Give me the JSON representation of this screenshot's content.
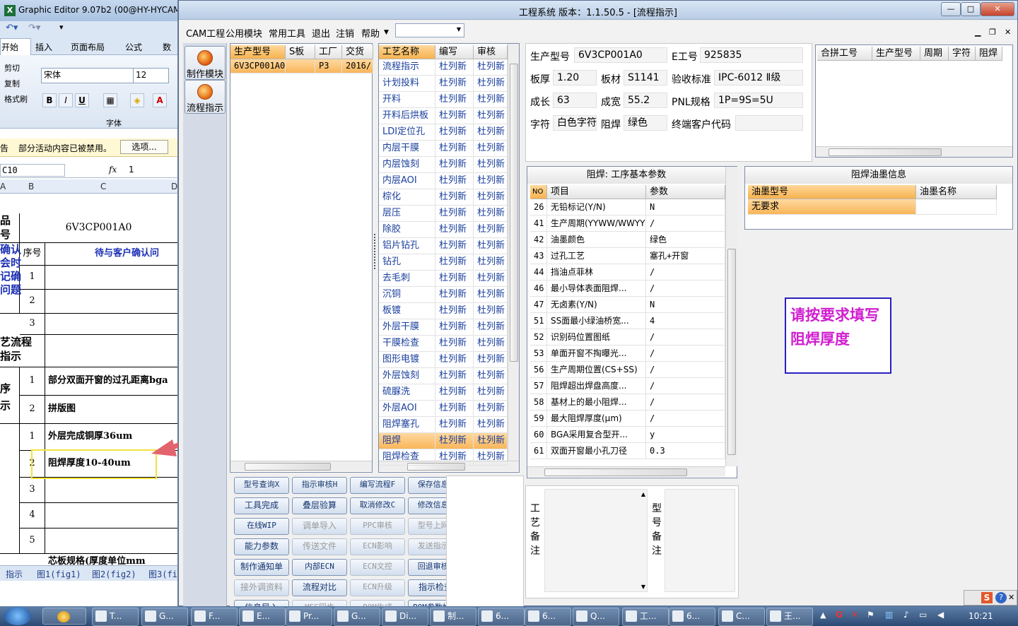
{
  "excel": {
    "title": "Graphic Editor 9.07b2 (00@HY-HYCAM",
    "tabs": [
      "开始",
      "插入",
      "页面布局",
      "公式",
      "数"
    ],
    "clip": {
      "cut": "剪切",
      "copy": "复制",
      "painter": "格式刷"
    },
    "font_name": "宋体",
    "font_size": "12",
    "group_font": "字体",
    "msg": "部分活动内容已被禁用。",
    "msg_prefix": "告",
    "msg_btn": "选项...",
    "namebox": "C10",
    "fx": "fx",
    "formula": "1",
    "cols": [
      "A",
      "B",
      "C",
      "D"
    ],
    "part_no": "6V3CP001A0",
    "hdr_seq": "序号",
    "hdr_pending": "待与客户确认问",
    "left_labels": {
      "pin": "品\n号",
      "confirm": "确认\n会时\n记确\n问题",
      "flow": "艺流程\n指示",
      "seq": "序\n示"
    },
    "rows1": [
      "1",
      "2",
      "3"
    ],
    "flow_rows": [
      {
        "n": "1",
        "t": "部分双面开窗的过孔距离bga"
      },
      {
        "n": "2",
        "t": "拼版图"
      }
    ],
    "req_rows": [
      {
        "n": "1",
        "t": "外层完成铜厚36um"
      },
      {
        "n": "2",
        "t": "阻焊厚度10-40um"
      },
      {
        "n": "3",
        "t": ""
      },
      {
        "n": "4",
        "t": ""
      },
      {
        "n": "5",
        "t": ""
      }
    ],
    "last_row": "芯板规格(厚度单位mm",
    "sheet_tabs": [
      "指示",
      "图1(fig1)",
      "图2(fig2)",
      "图3(fi"
    ]
  },
  "main": {
    "title": "工程系统   版本：1.1.50.5 - [流程指示]",
    "menu": [
      "CAM工程",
      "公用模块",
      "常用工具",
      "退出",
      "注销",
      "帮助"
    ],
    "modules": [
      "制作模块",
      "流程指示"
    ],
    "order_grid": {
      "headers": [
        "生产型号",
        "S板",
        "工厂",
        "交货日"
      ],
      "rows": [
        [
          "6V3CP001A0",
          "",
          "P3",
          "2016/"
        ]
      ]
    },
    "process_grid": {
      "headers": [
        "工艺名称",
        "编写",
        "审核"
      ],
      "rows": [
        [
          "流程指示",
          "杜列新",
          "杜列新"
        ],
        [
          "计划投料",
          "杜列新",
          "杜列新"
        ],
        [
          "开料",
          "杜列新",
          "杜列新"
        ],
        [
          "开料后烘板",
          "杜列新",
          "杜列新"
        ],
        [
          "LDI定位孔",
          "杜列新",
          "杜列新"
        ],
        [
          "内层干膜",
          "杜列新",
          "杜列新"
        ],
        [
          "内层蚀刻",
          "杜列新",
          "杜列新"
        ],
        [
          "内层AOI",
          "杜列新",
          "杜列新"
        ],
        [
          "棕化",
          "杜列新",
          "杜列新"
        ],
        [
          "层压",
          "杜列新",
          "杜列新"
        ],
        [
          "除胶",
          "杜列新",
          "杜列新"
        ],
        [
          "铝片钻孔",
          "杜列新",
          "杜列新"
        ],
        [
          "钻孔",
          "杜列新",
          "杜列新"
        ],
        [
          "去毛刺",
          "杜列新",
          "杜列新"
        ],
        [
          "沉铜",
          "杜列新",
          "杜列新"
        ],
        [
          "板镀",
          "杜列新",
          "杜列新"
        ],
        [
          "外层干膜",
          "杜列新",
          "杜列新"
        ],
        [
          "干膜检查",
          "杜列新",
          "杜列新"
        ],
        [
          "图形电镀",
          "杜列新",
          "杜列新"
        ],
        [
          "外层蚀刻",
          "杜列新",
          "杜列新"
        ],
        [
          "硫脲洗",
          "杜列新",
          "杜列新"
        ],
        [
          "外层AOI",
          "杜列新",
          "杜列新"
        ],
        [
          "阻焊塞孔",
          "杜列新",
          "杜列新"
        ],
        [
          "阻焊",
          "杜列新",
          "杜列新"
        ],
        [
          "阻焊检查",
          "杜列新",
          "杜列新"
        ]
      ],
      "selected": 23
    },
    "info": {
      "part_label": "生产型号",
      "part_value": "6V3CP001A0",
      "e_label": "E工号",
      "e_value": "925835",
      "thick_label": "板厚",
      "thick_value": "1.20",
      "mat_label": "板材",
      "mat_value": "S1141",
      "std_label": "验收标准",
      "std_value": "IPC-6012 Ⅱ级",
      "len_label": "成长",
      "len_value": "63",
      "wid_label": "成宽",
      "wid_value": "55.2",
      "pnl_label": "PNL规格",
      "pnl_value": "1P=9S=5U",
      "char_label": "字符",
      "char_value": "白色字符",
      "sm_label": "阻焊",
      "sm_value": "绿色",
      "cust_label": "终端客户代码",
      "cust_value": ""
    },
    "merge_grid": {
      "headers": [
        "合拼工号",
        "生产型号",
        "周期",
        "字符",
        "阻焊"
      ]
    },
    "param_panel": {
      "title": "阻焊: 工序基本参数",
      "headers": [
        "NO",
        "项目",
        "参数"
      ],
      "rows": [
        [
          "26",
          "无铅标记(Y/N)",
          "N"
        ],
        [
          "41",
          "生产周期(YYWW/WWYY)",
          "/"
        ],
        [
          "42",
          "油墨颜色",
          "绿色"
        ],
        [
          "43",
          "过孔工艺",
          "塞孔+开窗"
        ],
        [
          "44",
          "挡油点菲林",
          "/"
        ],
        [
          "46",
          "最小导体表面阻焊...",
          "/"
        ],
        [
          "47",
          "无卤素(Y/N)",
          "N"
        ],
        [
          "51",
          "SS面最小绿油桥宽...",
          "4"
        ],
        [
          "52",
          "识别码位置图纸",
          "/"
        ],
        [
          "53",
          "单面开窗不掏曝光...",
          "/"
        ],
        [
          "56",
          "生产周期位置(CS+SS)",
          "/"
        ],
        [
          "57",
          "阻焊超出焊盘高度...",
          "/"
        ],
        [
          "58",
          "基材上的最小阻焊...",
          "/"
        ],
        [
          "59",
          "最大阻焊厚度(μm)",
          "/"
        ],
        [
          "60",
          "BGA采用复合型开...",
          "y"
        ],
        [
          "61",
          "双面开窗最小孔刀径",
          "0.3"
        ]
      ]
    },
    "ink_panel": {
      "title": "阻焊油墨信息",
      "headers": [
        "油墨型号",
        "油墨名称"
      ],
      "rows": [
        [
          "无要求",
          ""
        ]
      ]
    },
    "note": "请按要求填写阻焊厚度",
    "remark_labels": {
      "process": "工\n艺\n备\n注",
      "part": "型\n号\n备\n注"
    },
    "buttons": [
      {
        "label": "型号查询X",
        "dis": false
      },
      {
        "label": "指示审核H",
        "dis": false
      },
      {
        "label": "编写流程F",
        "dis": false
      },
      {
        "label": "保存信息S",
        "dis": false
      },
      {
        "label": "工具完成",
        "dis": false
      },
      {
        "label": "叠层验算",
        "dis": false
      },
      {
        "label": "取消修改C",
        "dis": false
      },
      {
        "label": "修改信息B",
        "dis": false
      },
      {
        "label": "在线WIP",
        "dis": false
      },
      {
        "label": "调单导入",
        "dis": true
      },
      {
        "label": "PPC审核",
        "dis": true
      },
      {
        "label": "型号上网W",
        "dis": true
      },
      {
        "label": "能力参数",
        "dis": false
      },
      {
        "label": "传送文件",
        "dis": true
      },
      {
        "label": "ECN影响",
        "dis": true
      },
      {
        "label": "发送指示V",
        "dis": true
      },
      {
        "label": "制作通知单",
        "dis": false
      },
      {
        "label": "内部ECN",
        "dis": false
      },
      {
        "label": "ECN文控",
        "dis": true
      },
      {
        "label": "回退审核B",
        "dis": false
      },
      {
        "label": "接外调资料",
        "dis": true
      },
      {
        "label": "流程对比",
        "dis": false
      },
      {
        "label": "ECN升级",
        "dis": true
      },
      {
        "label": "指示检查",
        "dis": false
      },
      {
        "label": "信息导入",
        "dis": false
      },
      {
        "label": "MES同步",
        "dis": true
      },
      {
        "label": "BOM生成",
        "dis": true
      },
      {
        "label": "BOM参数检查",
        "dis": false
      }
    ]
  },
  "taskbar": {
    "items": [
      "T...",
      "G...",
      "F...",
      "E...",
      "Pr...",
      "G...",
      "Di...",
      "制...",
      "6...",
      "6...",
      "Q...",
      "工...",
      "6...",
      "C...",
      "王..."
    ],
    "time": "10:21"
  }
}
